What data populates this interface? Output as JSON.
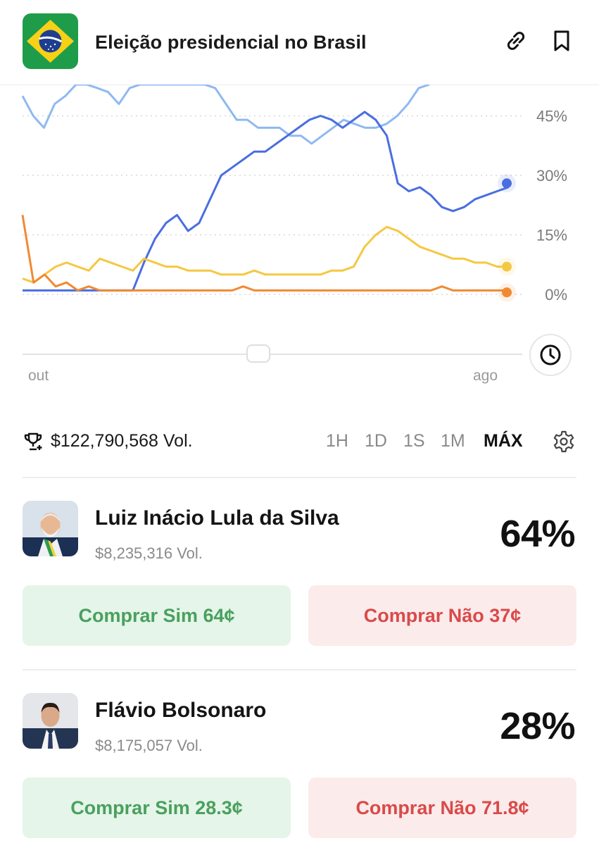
{
  "header": {
    "title": "Eleição presidencial no Brasil"
  },
  "icons": {
    "flag": "brazil-flag",
    "link": "link-icon",
    "bookmark": "bookmark-icon",
    "clock": "clock-icon",
    "trophy": "trophy-icon",
    "settings": "gear-icon"
  },
  "chart_data": {
    "type": "line",
    "ylim": [
      0,
      55
    ],
    "yticks": [
      "45%",
      "30%",
      "15%",
      "0%"
    ],
    "ytick_values": [
      45,
      30,
      15,
      0
    ],
    "xlabels": [
      "out",
      "ago"
    ],
    "grid": true,
    "series": [
      {
        "color": "#8fb9f0",
        "values": [
          50,
          45,
          42,
          48,
          50,
          55,
          53,
          52,
          51,
          48,
          52,
          54,
          55,
          55,
          54,
          55,
          54,
          55,
          52,
          48,
          44,
          44,
          42,
          42,
          42,
          40,
          40,
          38,
          40,
          42,
          44,
          43,
          42,
          42,
          43,
          45,
          48,
          52,
          55
        ]
      },
      {
        "color": "#4a6ee0",
        "values": [
          1,
          1,
          1,
          1,
          1,
          1,
          1,
          1,
          1,
          1,
          1,
          8,
          14,
          18,
          20,
          16,
          18,
          24,
          30,
          32,
          34,
          36,
          36,
          38,
          40,
          42,
          44,
          45,
          44,
          42,
          44,
          46,
          44,
          40,
          28,
          26,
          27,
          25,
          22,
          21,
          22,
          24,
          25,
          26,
          27
        ]
      },
      {
        "color": "#f5c842",
        "values": [
          4,
          3,
          5,
          7,
          8,
          7,
          6,
          9,
          8,
          7,
          6,
          9,
          8,
          7,
          7,
          6,
          6,
          6,
          5,
          5,
          5,
          6,
          5,
          5,
          5,
          5,
          5,
          5,
          6,
          6,
          7,
          12,
          15,
          17,
          16,
          14,
          12,
          11,
          10,
          9,
          9,
          8,
          8,
          7,
          7
        ]
      },
      {
        "color": "#f08a32",
        "values": [
          20,
          3,
          5,
          2,
          3,
          1,
          2,
          1,
          1,
          1,
          1,
          1,
          1,
          1,
          1,
          1,
          1,
          1,
          1,
          1,
          2,
          1,
          1,
          1,
          1,
          1,
          1,
          1,
          1,
          1,
          1,
          1,
          1,
          1,
          1,
          1,
          1,
          1,
          2,
          1,
          1,
          1,
          1,
          1,
          1
        ]
      }
    ],
    "endpoints": [
      {
        "color": "#4a6ee0",
        "value": 28
      },
      {
        "color": "#f5c842",
        "value": 7
      },
      {
        "color": "#f08a32",
        "value": 0.5
      }
    ]
  },
  "volume": {
    "total": "$122,790,568 Vol.",
    "ranges": [
      "1H",
      "1D",
      "1S",
      "1M",
      "MÁX"
    ],
    "active_range": "MÁX"
  },
  "candidates": [
    {
      "name": "Luiz Inácio Lula da Silva",
      "vol": "$8,235,316 Vol.",
      "pct": "64%",
      "yes": "Comprar Sim 64¢",
      "no": "Comprar Não 37¢"
    },
    {
      "name": "Flávio Bolsonaro",
      "vol": "$8,175,057 Vol.",
      "pct": "28%",
      "yes": "Comprar Sim 28.3¢",
      "no": "Comprar Não 71.8¢"
    }
  ]
}
